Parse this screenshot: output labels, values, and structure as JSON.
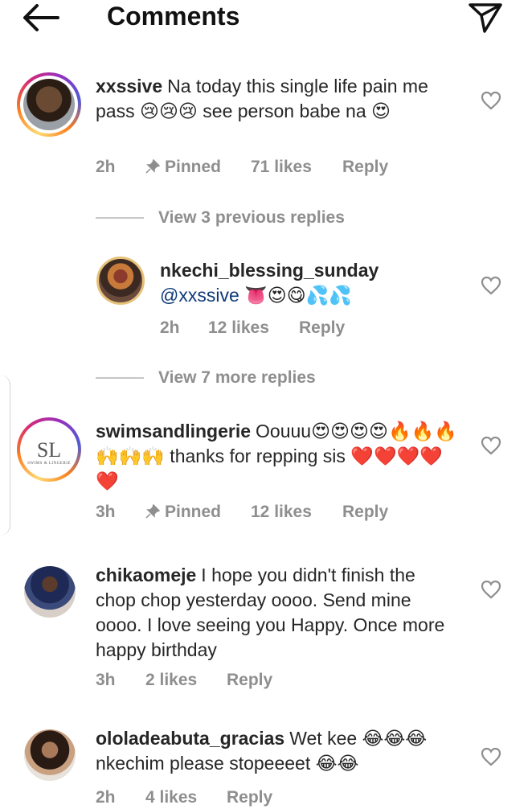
{
  "header": {
    "title": "Comments",
    "back_icon": "arrow-left-icon",
    "send_icon": "send-icon"
  },
  "comments": [
    {
      "username": "xxssive",
      "text": "Na today this single life pain me pass 😢😢😢 see person babe na 😍",
      "time": "2h",
      "pinned": "Pinned",
      "likes": "71 likes",
      "reply": "Reply"
    },
    {
      "username": "nkechi_blessing_sunday",
      "mention": "@xxssive",
      "emojis": "👅😍😋💦💦",
      "time": "2h",
      "likes": "12 likes",
      "reply": "Reply"
    },
    {
      "username": "swimsandlingerie",
      "text": "Oouuu😍😍😍😍🔥🔥🔥🙌🙌🙌 thanks for repping sis ❤️❤️❤️❤️❤️",
      "time": "3h",
      "pinned": "Pinned",
      "likes": "12 likes",
      "reply": "Reply",
      "logo_main": "SL",
      "logo_sub": "SWIMS & LINGERIE"
    },
    {
      "username": "chikaomeje",
      "text": "I hope you didn't finish the chop chop yesterday oooo. Send mine oooo. I love seeing you Happy. Once more happy birthday",
      "time": "3h",
      "likes": "2 likes",
      "reply": "Reply"
    },
    {
      "username": "ololadeabuta_gracias",
      "text": "Wet kee 😂😂😂 nkechim please stopeeeet 😂😂",
      "time": "2h",
      "likes": "4 likes",
      "reply": "Reply"
    }
  ],
  "view_previous": "View 3 previous replies",
  "view_more": "View 7 more replies",
  "colors": {
    "text": "#262626",
    "meta": "#8e8e8e",
    "mention": "#0f3a78"
  }
}
